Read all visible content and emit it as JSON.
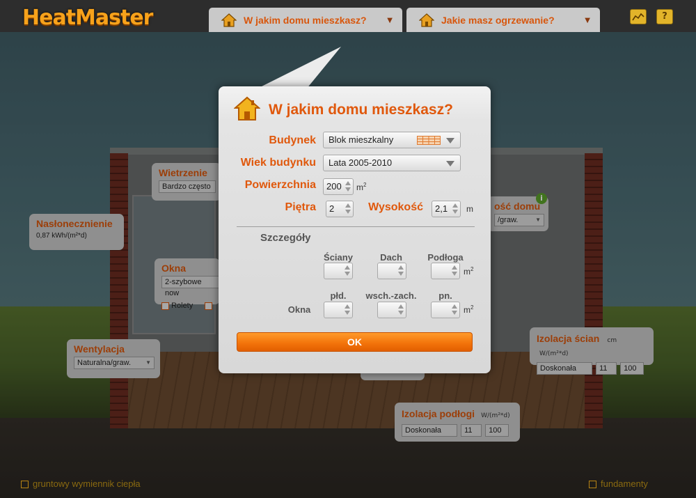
{
  "header": {
    "logo": "HeatMaster",
    "tab_house": "W jakim domu mieszkasz?",
    "tab_heating": "Jakie masz ogrzewanie?",
    "help_label": "?"
  },
  "scene": {
    "wietrzenie": {
      "title": "Wietrzenie",
      "value": "Bardzo często"
    },
    "naslonecznienie": {
      "title": "Nasłonecznienie",
      "value": "0,87 kWh/(m²*d)"
    },
    "okna": {
      "title": "Okna",
      "value": "2-szybowe now",
      "rolety": "Rolety"
    },
    "wentylacja": {
      "title": "Wentylacja",
      "value": "Naturalna/graw."
    },
    "szczelnosc": {
      "title": "ość domu",
      "value": "/graw."
    },
    "izolacja_scian": {
      "title": "Izolacja ścian",
      "cm": "cm",
      "unit": "W/(m²*d)",
      "value": "Doskonała",
      "n1": "11",
      "n2": "100"
    },
    "izolacja_podlogi": {
      "title": "Izolacja podłogi",
      "unit": "W/(m²*d)",
      "value": "Doskonała",
      "n1": "11",
      "n2": "100"
    },
    "footer_left": "gruntowy wymiennik ciepła",
    "footer_right": "fundamenty"
  },
  "modal": {
    "title": "W jakim domu mieszkasz?",
    "budynek_label": "Budynek",
    "budynek_value": "Blok mieszkalny",
    "wiek_label": "Wiek budynku",
    "wiek_value": "Lata 2005-2010",
    "powierzchnia_label": "Powierzchnia",
    "powierzchnia_value": "200",
    "powierzchnia_unit": "m",
    "pietra_label": "Piętra",
    "pietra_value": "2",
    "wysokosc_label": "Wysokość",
    "wysokosc_value": "2,1",
    "wysokosc_unit": "m",
    "details_title": "Szczegóły",
    "col_sciany": "Ściany",
    "col_dach": "Dach",
    "col_podloga": "Podłoga",
    "unit_m": "m",
    "okna_label": "Okna",
    "col_pld": "płd.",
    "col_wschzach": "wsch.-zach.",
    "col_pn": "pn.",
    "ok_label": "OK"
  },
  "colors": {
    "accent": "#e0580c",
    "ok_button": "#f2720a"
  }
}
